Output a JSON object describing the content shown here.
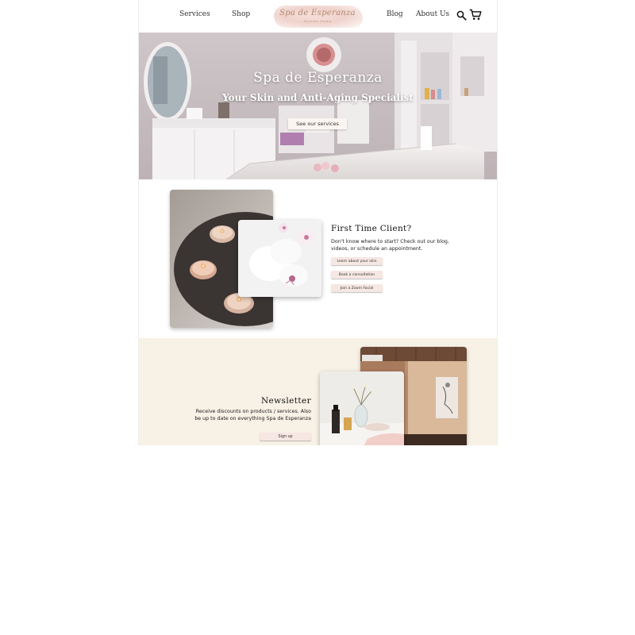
{
  "header": {
    "nav_left": [
      "Services",
      "Shop"
    ],
    "nav_right": [
      "Blog",
      "About Us"
    ],
    "logo": {
      "script_text": "Spa de Esperanza",
      "tagline": "Skincare Studio"
    },
    "icons": {
      "search": "search-icon",
      "cart": "cart-icon"
    }
  },
  "hero": {
    "title": "Spa de Esperanza",
    "subtitle": "Your Skin and Anti-Aging Specialist",
    "cta_label": "See our services"
  },
  "first_time": {
    "heading": "First Time Client?",
    "body": "Don't know where to start? Check out our blog, videos, or schedule an appointment.",
    "buttons": [
      "Learn about your skin",
      "Book a consultation",
      "Join a Zoom Facial"
    ]
  },
  "newsletter": {
    "heading": "Newsletter",
    "body": "Receive discounts on products / services. Also be up to date on everything Spa de Esperanza",
    "button_label": "Sign up"
  },
  "colors": {
    "button_pink": "#f6e7e2",
    "newsletter_bg": "#f7f1e6",
    "hero_text": "#ffffff"
  }
}
